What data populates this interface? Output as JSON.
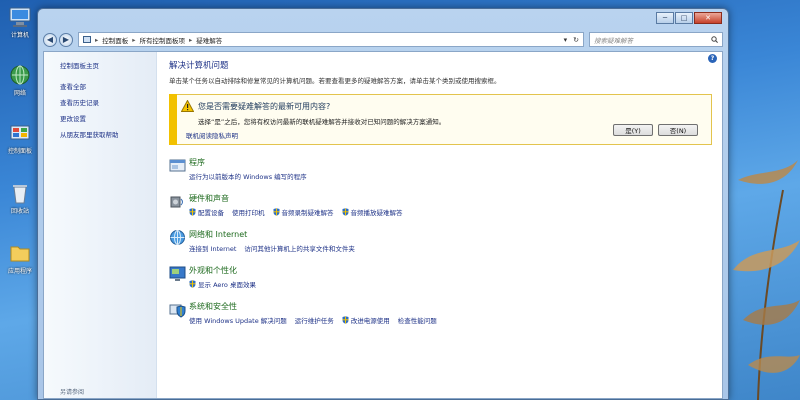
{
  "desktop": {
    "icons": [
      {
        "label": "计算机",
        "icon": "computer-icon"
      },
      {
        "label": "网络",
        "icon": "network-icon"
      },
      {
        "label": "控制面板",
        "icon": "control-panel-icon"
      },
      {
        "label": "回收站",
        "icon": "recycle-bin-icon"
      },
      {
        "label": "应用程序",
        "icon": "folder-icon"
      }
    ]
  },
  "window": {
    "caption_buttons": {
      "minimize": "─",
      "maximize": "□",
      "close": "✕"
    },
    "address": {
      "back": "◀",
      "forward": "▶",
      "crumbs": [
        "控制面板",
        "所有控制面板项",
        "疑难解答"
      ],
      "dropdown": "▾",
      "refresh": "↻"
    },
    "search": {
      "placeholder": "搜索疑难解答"
    }
  },
  "sidebar": {
    "home": "控制面板主页",
    "links": [
      "查看全部",
      "查看历史记录",
      "更改设置",
      "从朋友那里获取帮助"
    ],
    "see_also": "另请参阅"
  },
  "main": {
    "help": "?",
    "title": "解决计算机问题",
    "subtitle": "单击某个任务以自动排除和修复常见的计算机问题。若要查看更多的疑难解答方案，请单击某个类别或使用搜索框。",
    "notice": {
      "question": "您是否需要疑难解答的最新可用内容?",
      "description": "选择“是”之后，您将有权访问最新的联机疑难解答并接收对已知问题的解决方案通知。",
      "privacy_link": "联机阅读隐私声明",
      "yes_button": "是(Y)",
      "no_button": "否(N)"
    },
    "categories": [
      {
        "title": "程序",
        "icon": "programs-icon",
        "links": [
          {
            "text": "运行为以前版本的 Windows 编写的程序",
            "shield": false
          }
        ]
      },
      {
        "title": "硬件和声音",
        "icon": "hardware-sound-icon",
        "links": [
          {
            "text": "配置设备",
            "shield": true
          },
          {
            "text": "使用打印机",
            "shield": false
          },
          {
            "text": "音频录制疑难解答",
            "shield": true
          },
          {
            "text": "音频播放疑难解答",
            "shield": true
          }
        ]
      },
      {
        "title": "网络和 Internet",
        "icon": "network-internet-icon",
        "links": [
          {
            "text": "连接到 Internet",
            "shield": false
          },
          {
            "text": "访问其他计算机上的共享文件和文件夹",
            "shield": false
          }
        ]
      },
      {
        "title": "外观和个性化",
        "icon": "appearance-icon",
        "links": [
          {
            "text": "显示 Aero 桌面效果",
            "shield": true
          }
        ]
      },
      {
        "title": "系统和安全性",
        "icon": "system-security-icon",
        "links": [
          {
            "text": "使用 Windows Update 解决问题",
            "shield": false
          },
          {
            "text": "运行维护任务",
            "shield": false
          },
          {
            "text": "改进电源使用",
            "shield": true
          },
          {
            "text": "检查性能问题",
            "shield": false
          }
        ]
      }
    ]
  }
}
